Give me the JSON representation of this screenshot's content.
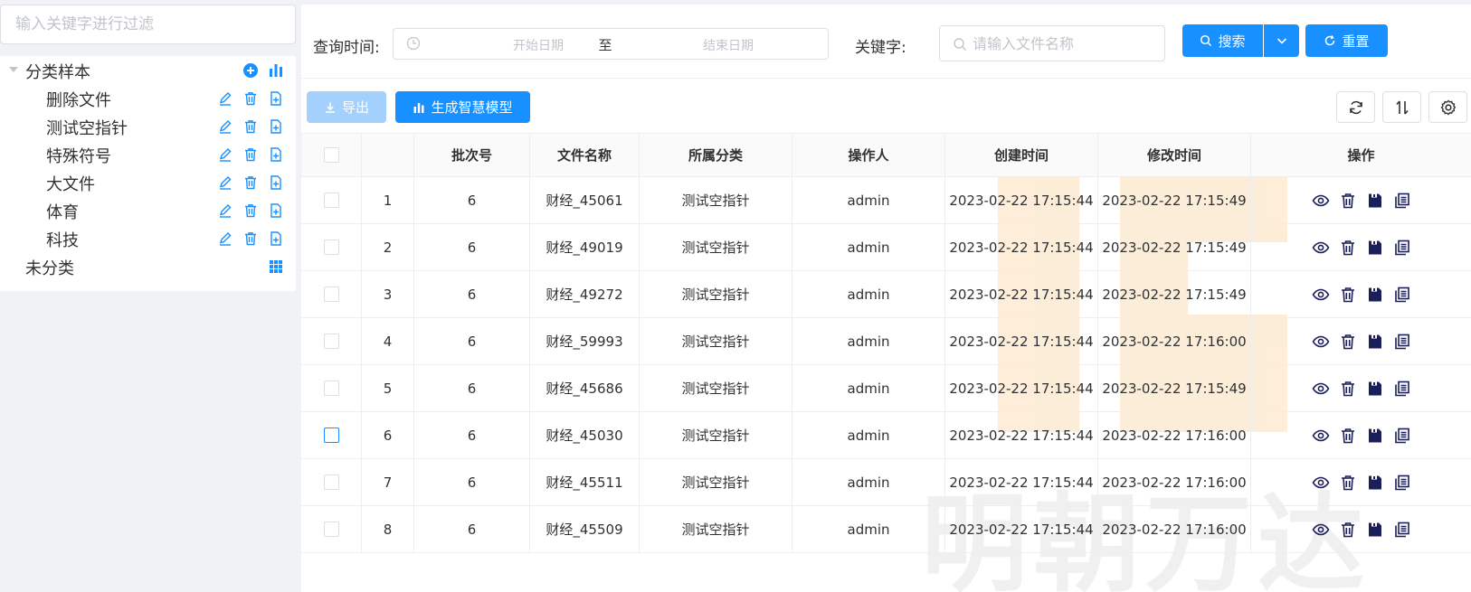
{
  "sidebar": {
    "filter_placeholder": "输入关键字进行过滤",
    "root_label": "分类样本",
    "children": [
      "删除文件",
      "测试空指针",
      "特殊符号",
      "大文件",
      "体育",
      "科技"
    ],
    "uncategorized_label": "未分类"
  },
  "search": {
    "time_label": "查询时间:",
    "start_placeholder": "开始日期",
    "range_separator": "至",
    "end_placeholder": "结束日期",
    "keyword_label": "关键字:",
    "keyword_placeholder": "请输入文件名称",
    "search_button": "搜索",
    "reset_button": "重置"
  },
  "toolbar": {
    "export_button": "导出",
    "model_button": "生成智慧模型"
  },
  "table": {
    "columns": [
      "",
      "",
      "批次号",
      "文件名称",
      "所属分类",
      "操作人",
      "创建时间",
      "修改时间",
      "操作"
    ],
    "rows": [
      {
        "index": "1",
        "batch": "6",
        "file": "财经_45061",
        "category": "测试空指针",
        "operator": "admin",
        "created": "2023-02-22 17:15:44",
        "modified": "2023-02-22 17:15:49"
      },
      {
        "index": "2",
        "batch": "6",
        "file": "财经_49019",
        "category": "测试空指针",
        "operator": "admin",
        "created": "2023-02-22 17:15:44",
        "modified": "2023-02-22 17:15:49"
      },
      {
        "index": "3",
        "batch": "6",
        "file": "财经_49272",
        "category": "测试空指针",
        "operator": "admin",
        "created": "2023-02-22 17:15:44",
        "modified": "2023-02-22 17:15:49"
      },
      {
        "index": "4",
        "batch": "6",
        "file": "财经_59993",
        "category": "测试空指针",
        "operator": "admin",
        "created": "2023-02-22 17:15:44",
        "modified": "2023-02-22 17:16:00"
      },
      {
        "index": "5",
        "batch": "6",
        "file": "财经_45686",
        "category": "测试空指针",
        "operator": "admin",
        "created": "2023-02-22 17:15:44",
        "modified": "2023-02-22 17:15:49"
      },
      {
        "index": "6",
        "batch": "6",
        "file": "财经_45030",
        "category": "测试空指针",
        "operator": "admin",
        "created": "2023-02-22 17:15:44",
        "modified": "2023-02-22 17:16:00"
      },
      {
        "index": "7",
        "batch": "6",
        "file": "财经_45511",
        "category": "测试空指针",
        "operator": "admin",
        "created": "2023-02-22 17:15:44",
        "modified": "2023-02-22 17:16:00"
      },
      {
        "index": "8",
        "batch": "6",
        "file": "财经_45509",
        "category": "测试空指针",
        "operator": "admin",
        "created": "2023-02-22 17:15:44",
        "modified": "2023-02-22 17:16:00"
      }
    ],
    "row_actions": [
      "view-icon",
      "delete-icon",
      "save-icon",
      "copy-icon"
    ],
    "focused_row_index": 5
  },
  "watermark": "明朝万达",
  "colors": {
    "primary": "#1890ff",
    "primary_disabled": "#a3d0fd",
    "action_icon": "#1a1f5c",
    "tree_icon": "#1890ff"
  }
}
